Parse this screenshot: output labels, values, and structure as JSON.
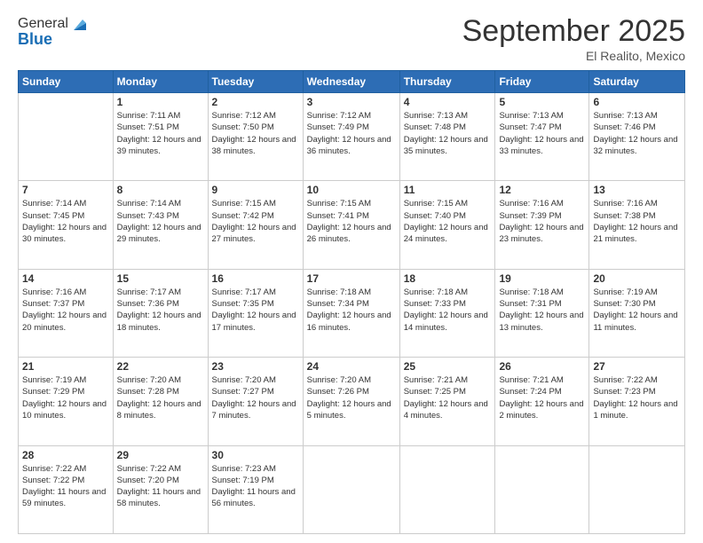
{
  "logo": {
    "general": "General",
    "blue": "Blue"
  },
  "title": "September 2025",
  "location": "El Realito, Mexico",
  "days_of_week": [
    "Sunday",
    "Monday",
    "Tuesday",
    "Wednesday",
    "Thursday",
    "Friday",
    "Saturday"
  ],
  "weeks": [
    [
      {
        "day": "",
        "sunrise": "",
        "sunset": "",
        "daylight": ""
      },
      {
        "day": "1",
        "sunrise": "7:11 AM",
        "sunset": "7:51 PM",
        "daylight": "12 hours and 39 minutes."
      },
      {
        "day": "2",
        "sunrise": "7:12 AM",
        "sunset": "7:50 PM",
        "daylight": "12 hours and 38 minutes."
      },
      {
        "day": "3",
        "sunrise": "7:12 AM",
        "sunset": "7:49 PM",
        "daylight": "12 hours and 36 minutes."
      },
      {
        "day": "4",
        "sunrise": "7:13 AM",
        "sunset": "7:48 PM",
        "daylight": "12 hours and 35 minutes."
      },
      {
        "day": "5",
        "sunrise": "7:13 AM",
        "sunset": "7:47 PM",
        "daylight": "12 hours and 33 minutes."
      },
      {
        "day": "6",
        "sunrise": "7:13 AM",
        "sunset": "7:46 PM",
        "daylight": "12 hours and 32 minutes."
      }
    ],
    [
      {
        "day": "7",
        "sunrise": "7:14 AM",
        "sunset": "7:45 PM",
        "daylight": "12 hours and 30 minutes."
      },
      {
        "day": "8",
        "sunrise": "7:14 AM",
        "sunset": "7:43 PM",
        "daylight": "12 hours and 29 minutes."
      },
      {
        "day": "9",
        "sunrise": "7:15 AM",
        "sunset": "7:42 PM",
        "daylight": "12 hours and 27 minutes."
      },
      {
        "day": "10",
        "sunrise": "7:15 AM",
        "sunset": "7:41 PM",
        "daylight": "12 hours and 26 minutes."
      },
      {
        "day": "11",
        "sunrise": "7:15 AM",
        "sunset": "7:40 PM",
        "daylight": "12 hours and 24 minutes."
      },
      {
        "day": "12",
        "sunrise": "7:16 AM",
        "sunset": "7:39 PM",
        "daylight": "12 hours and 23 minutes."
      },
      {
        "day": "13",
        "sunrise": "7:16 AM",
        "sunset": "7:38 PM",
        "daylight": "12 hours and 21 minutes."
      }
    ],
    [
      {
        "day": "14",
        "sunrise": "7:16 AM",
        "sunset": "7:37 PM",
        "daylight": "12 hours and 20 minutes."
      },
      {
        "day": "15",
        "sunrise": "7:17 AM",
        "sunset": "7:36 PM",
        "daylight": "12 hours and 18 minutes."
      },
      {
        "day": "16",
        "sunrise": "7:17 AM",
        "sunset": "7:35 PM",
        "daylight": "12 hours and 17 minutes."
      },
      {
        "day": "17",
        "sunrise": "7:18 AM",
        "sunset": "7:34 PM",
        "daylight": "12 hours and 16 minutes."
      },
      {
        "day": "18",
        "sunrise": "7:18 AM",
        "sunset": "7:33 PM",
        "daylight": "12 hours and 14 minutes."
      },
      {
        "day": "19",
        "sunrise": "7:18 AM",
        "sunset": "7:31 PM",
        "daylight": "12 hours and 13 minutes."
      },
      {
        "day": "20",
        "sunrise": "7:19 AM",
        "sunset": "7:30 PM",
        "daylight": "12 hours and 11 minutes."
      }
    ],
    [
      {
        "day": "21",
        "sunrise": "7:19 AM",
        "sunset": "7:29 PM",
        "daylight": "12 hours and 10 minutes."
      },
      {
        "day": "22",
        "sunrise": "7:20 AM",
        "sunset": "7:28 PM",
        "daylight": "12 hours and 8 minutes."
      },
      {
        "day": "23",
        "sunrise": "7:20 AM",
        "sunset": "7:27 PM",
        "daylight": "12 hours and 7 minutes."
      },
      {
        "day": "24",
        "sunrise": "7:20 AM",
        "sunset": "7:26 PM",
        "daylight": "12 hours and 5 minutes."
      },
      {
        "day": "25",
        "sunrise": "7:21 AM",
        "sunset": "7:25 PM",
        "daylight": "12 hours and 4 minutes."
      },
      {
        "day": "26",
        "sunrise": "7:21 AM",
        "sunset": "7:24 PM",
        "daylight": "12 hours and 2 minutes."
      },
      {
        "day": "27",
        "sunrise": "7:22 AM",
        "sunset": "7:23 PM",
        "daylight": "12 hours and 1 minute."
      }
    ],
    [
      {
        "day": "28",
        "sunrise": "7:22 AM",
        "sunset": "7:22 PM",
        "daylight": "11 hours and 59 minutes."
      },
      {
        "day": "29",
        "sunrise": "7:22 AM",
        "sunset": "7:20 PM",
        "daylight": "11 hours and 58 minutes."
      },
      {
        "day": "30",
        "sunrise": "7:23 AM",
        "sunset": "7:19 PM",
        "daylight": "11 hours and 56 minutes."
      },
      {
        "day": "",
        "sunrise": "",
        "sunset": "",
        "daylight": ""
      },
      {
        "day": "",
        "sunrise": "",
        "sunset": "",
        "daylight": ""
      },
      {
        "day": "",
        "sunrise": "",
        "sunset": "",
        "daylight": ""
      },
      {
        "day": "",
        "sunrise": "",
        "sunset": "",
        "daylight": ""
      }
    ]
  ]
}
